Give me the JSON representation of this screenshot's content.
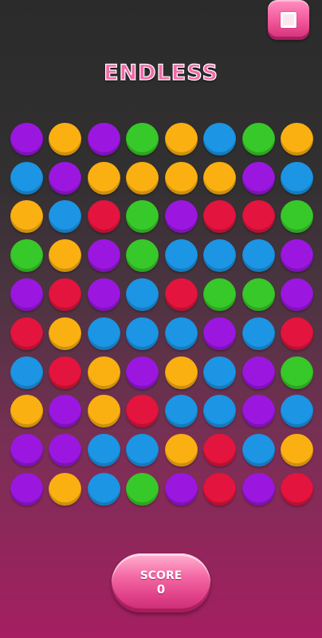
{
  "header": {
    "stop_button_icon": "stop-square-icon",
    "mode_title": "ENDLESS"
  },
  "colors": {
    "purple": "#9b17e0",
    "orange": "#fbb012",
    "blue": "#1b95e4",
    "green": "#37c829",
    "red": "#e3143d",
    "accent_pink": "#f06aa6"
  },
  "board": {
    "rows": 10,
    "cols": 8,
    "grid": [
      [
        "purple",
        "orange",
        "purple",
        "green",
        "orange",
        "blue",
        "green",
        "orange"
      ],
      [
        "blue",
        "purple",
        "orange",
        "orange",
        "orange",
        "orange",
        "purple",
        "blue"
      ],
      [
        "orange",
        "blue",
        "red",
        "green",
        "purple",
        "red",
        "red",
        "green"
      ],
      [
        "green",
        "orange",
        "purple",
        "green",
        "blue",
        "blue",
        "blue",
        "purple"
      ],
      [
        "purple",
        "red",
        "purple",
        "blue",
        "red",
        "green",
        "green",
        "purple"
      ],
      [
        "red",
        "orange",
        "blue",
        "blue",
        "blue",
        "purple",
        "blue",
        "red"
      ],
      [
        "blue",
        "red",
        "orange",
        "purple",
        "orange",
        "blue",
        "purple",
        "green"
      ],
      [
        "orange",
        "purple",
        "orange",
        "red",
        "blue",
        "blue",
        "purple",
        "blue"
      ],
      [
        "purple",
        "purple",
        "blue",
        "blue",
        "orange",
        "red",
        "blue",
        "orange"
      ],
      [
        "purple",
        "orange",
        "blue",
        "green",
        "purple",
        "red",
        "purple",
        "red"
      ]
    ]
  },
  "score": {
    "label": "SCORE",
    "value": "0"
  }
}
